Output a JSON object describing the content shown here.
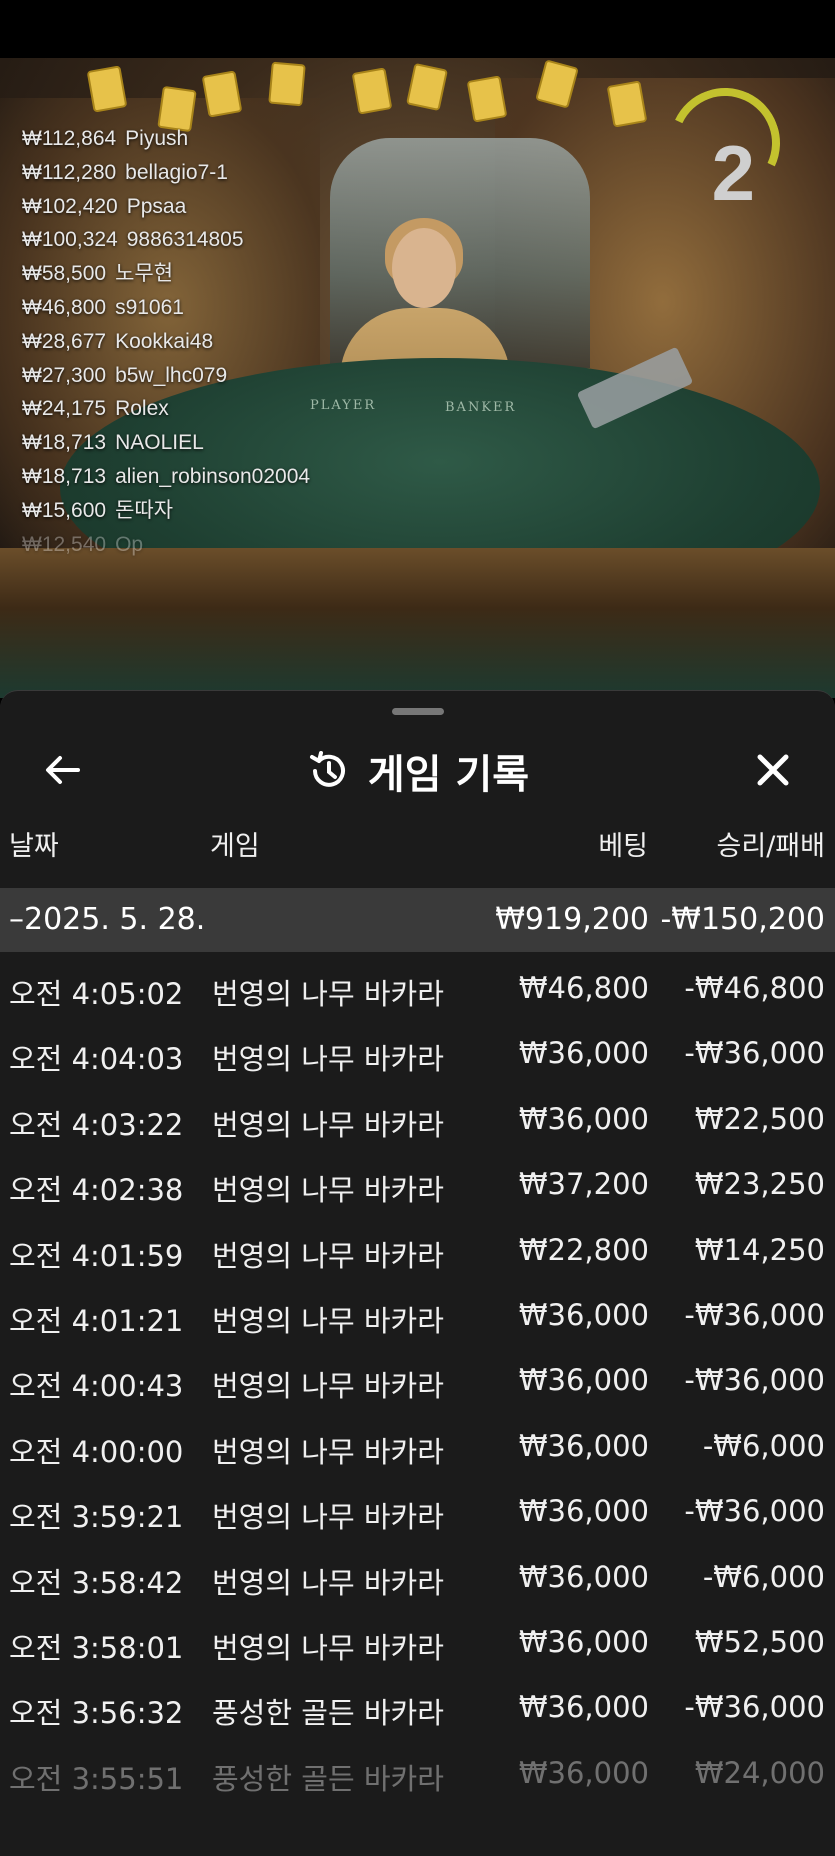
{
  "stream": {
    "countdown": "2",
    "winners": [
      {
        "amount": "₩112,864",
        "name": "Piyush"
      },
      {
        "amount": "₩112,280",
        "name": "bellagio7-1"
      },
      {
        "amount": "₩102,420",
        "name": "Ppsaa"
      },
      {
        "amount": "₩100,324",
        "name": "9886314805"
      },
      {
        "amount": "₩58,500",
        "name": "노무현"
      },
      {
        "amount": "₩46,800",
        "name": "s91061"
      },
      {
        "amount": "₩28,677",
        "name": "Kookkai48"
      },
      {
        "amount": "₩27,300",
        "name": "b5w_lhc079"
      },
      {
        "amount": "₩24,175",
        "name": "Rolex"
      },
      {
        "amount": "₩18,713",
        "name": "NAOLIEL"
      },
      {
        "amount": "₩18,713",
        "name": "alien_robinson02004"
      },
      {
        "amount": "₩15,600",
        "name": "돈따자"
      },
      {
        "amount": "₩12,540",
        "name": "Op"
      }
    ],
    "table_labels": {
      "player": "PLAYER",
      "banker": "BANKER"
    }
  },
  "sheet": {
    "title": "게임 기록",
    "icons": {
      "back": "arrow-left-icon",
      "history": "history-icon",
      "close": "close-icon"
    },
    "columns": {
      "date": "날짜",
      "game": "게임",
      "bet": "베팅",
      "result": "승리/패배"
    },
    "summary": {
      "date": "–2025. 5. 28.",
      "bet": "₩919,200",
      "result": "-₩150,200"
    },
    "rows": [
      {
        "time": "오전 4:05:02",
        "game": "번영의 나무 바카라",
        "bet": "₩46,800",
        "result": "-₩46,800"
      },
      {
        "time": "오전 4:04:03",
        "game": "번영의 나무 바카라",
        "bet": "₩36,000",
        "result": "-₩36,000"
      },
      {
        "time": "오전 4:03:22",
        "game": "번영의 나무 바카라",
        "bet": "₩36,000",
        "result": "₩22,500"
      },
      {
        "time": "오전 4:02:38",
        "game": "번영의 나무 바카라",
        "bet": "₩37,200",
        "result": "₩23,250"
      },
      {
        "time": "오전 4:01:59",
        "game": "번영의 나무 바카라",
        "bet": "₩22,800",
        "result": "₩14,250"
      },
      {
        "time": "오전 4:01:21",
        "game": "번영의 나무 바카라",
        "bet": "₩36,000",
        "result": "-₩36,000"
      },
      {
        "time": "오전 4:00:43",
        "game": "번영의 나무 바카라",
        "bet": "₩36,000",
        "result": "-₩36,000"
      },
      {
        "time": "오전 4:00:00",
        "game": "번영의 나무 바카라",
        "bet": "₩36,000",
        "result": "-₩6,000"
      },
      {
        "time": "오전 3:59:21",
        "game": "번영의 나무 바카라",
        "bet": "₩36,000",
        "result": "-₩36,000"
      },
      {
        "time": "오전 3:58:42",
        "game": "번영의 나무 바카라",
        "bet": "₩36,000",
        "result": "-₩6,000"
      },
      {
        "time": "오전 3:58:01",
        "game": "번영의 나무 바카라",
        "bet": "₩36,000",
        "result": "₩52,500"
      },
      {
        "time": "오전 3:56:32",
        "game": "풍성한 골든 바카라",
        "bet": "₩36,000",
        "result": "-₩36,000"
      },
      {
        "time": "오전 3:55:51",
        "game": "풍성한 골든 바카라",
        "bet": "₩36,000",
        "result": "₩24,000"
      }
    ]
  },
  "colors": {
    "sheet_bg": "#1b1b1b",
    "summary_bg": "#3a3a3a",
    "text": "#f0f0f0",
    "countdown_ring": "#c3c22e"
  }
}
